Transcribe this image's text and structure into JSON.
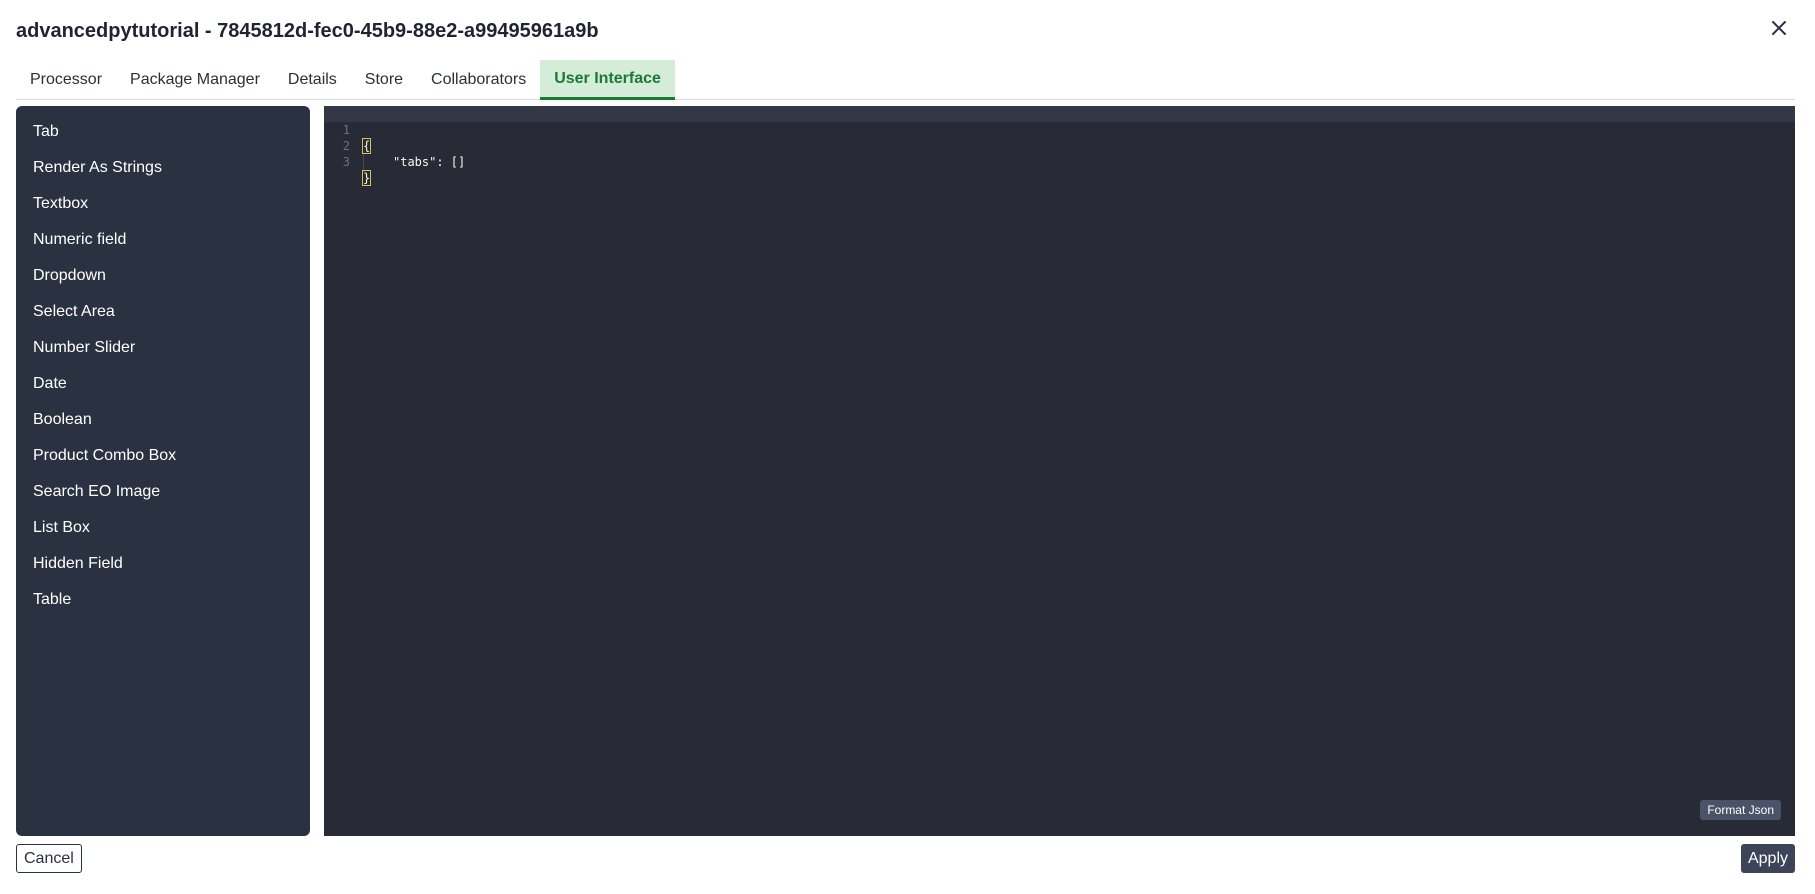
{
  "header": {
    "title": "advancedpytutorial - 7845812d-fec0-45b9-88e2-a99495961a9b",
    "close_icon": "close-icon"
  },
  "tabs": [
    {
      "label": "Processor"
    },
    {
      "label": "Package Manager"
    },
    {
      "label": "Details"
    },
    {
      "label": "Store"
    },
    {
      "label": "Collaborators"
    },
    {
      "label": "User Interface",
      "active": true
    }
  ],
  "sidebar": {
    "items": [
      {
        "label": "Tab"
      },
      {
        "label": "Render As Strings"
      },
      {
        "label": "Textbox"
      },
      {
        "label": "Numeric field"
      },
      {
        "label": "Dropdown"
      },
      {
        "label": "Select Area"
      },
      {
        "label": "Number Slider"
      },
      {
        "label": "Date"
      },
      {
        "label": "Boolean"
      },
      {
        "label": "Product Combo Box"
      },
      {
        "label": "Search EO Image"
      },
      {
        "label": "List Box"
      },
      {
        "label": "Hidden Field"
      },
      {
        "label": "Table"
      }
    ]
  },
  "editor": {
    "lines": [
      {
        "number": "1",
        "text": "{"
      },
      {
        "number": "2",
        "text": "\"tabs\": []"
      },
      {
        "number": "3",
        "text": "}"
      }
    ],
    "format_label": "Format Json"
  },
  "footer": {
    "cancel_label": "Cancel",
    "apply_label": "Apply"
  },
  "colors": {
    "accent": "#1a7a33",
    "active_tab_bg": "#d5ecd9",
    "panel_bg": "#2a3140",
    "editor_bg": "#282a36"
  }
}
